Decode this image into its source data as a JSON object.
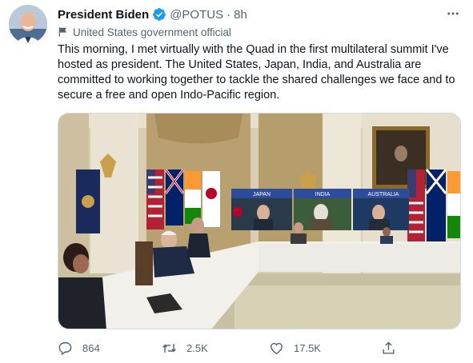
{
  "tweet": {
    "author_name": "President Biden",
    "handle": "@POTUS",
    "separator": "·",
    "time": "8h",
    "account_label": "United States government official",
    "text": "This morning, I met virtually with the Quad in the first multilateral summit I've hosted as president. The United States, Japan, India, and Australia are committed to working together to tackle the shared challenges we face and to secure a free and open Indo-Pacific region."
  },
  "photo": {
    "screen_labels": [
      "JAPAN",
      "INDIA",
      "AUSTRALIA"
    ]
  },
  "actions": {
    "reply_count": "864",
    "retweet_count": "2.5K",
    "like_count": "17.5K"
  },
  "colors": {
    "verified": "#1d9bf0",
    "secondary_text": "#536471",
    "primary_text": "#0f1419"
  },
  "icons": [
    "avatar",
    "verified-badge-icon",
    "more-icon",
    "flag-icon",
    "reply-icon",
    "retweet-icon",
    "like-icon",
    "share-icon"
  ]
}
